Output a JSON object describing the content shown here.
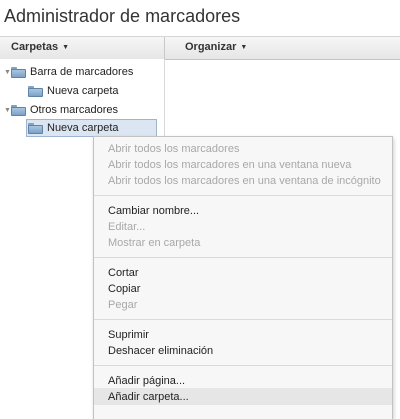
{
  "window": {
    "title": "Administrador de marcadores"
  },
  "toolbar": {
    "folders_label": "Carpetas",
    "organize_label": "Organizar",
    "caret": "▼"
  },
  "tree": {
    "items": [
      {
        "label": "Barra de marcadores",
        "expanded": true
      },
      {
        "label": "Nueva carpeta"
      },
      {
        "label": "Otros marcadores",
        "expanded": true
      },
      {
        "label": "Nueva carpeta",
        "selected": true
      }
    ],
    "expanded_arrow": "▼"
  },
  "context_menu": {
    "group1": [
      {
        "label": "Abrir todos los marcadores",
        "enabled": false
      },
      {
        "label": "Abrir todos los marcadores en una ventana nueva",
        "enabled": false
      },
      {
        "label": "Abrir todos los marcadores en una ventana de incógnito",
        "enabled": false
      }
    ],
    "group2": [
      {
        "label": "Cambiar nombre...",
        "enabled": true
      },
      {
        "label": "Editar...",
        "enabled": false
      },
      {
        "label": "Mostrar en carpeta",
        "enabled": false
      }
    ],
    "group3": [
      {
        "label": "Cortar",
        "enabled": true
      },
      {
        "label": "Copiar",
        "enabled": true
      },
      {
        "label": "Pegar",
        "enabled": false
      }
    ],
    "group4": [
      {
        "label": "Suprimir",
        "enabled": true
      },
      {
        "label": "Deshacer eliminación",
        "enabled": true
      }
    ],
    "group5": [
      {
        "label": "Añadir página...",
        "enabled": true
      },
      {
        "label": "Añadir carpeta...",
        "enabled": true,
        "highlighted": true
      }
    ]
  },
  "colors": {
    "selection_bg": "#dce6f2",
    "menu_bg": "#f7f7f7",
    "disabled_text": "#a8a8a8",
    "folder_blue": "#7da2c6"
  }
}
